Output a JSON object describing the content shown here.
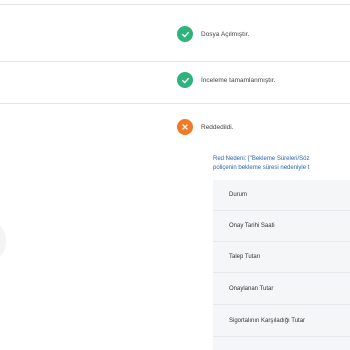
{
  "colors": {
    "success": "#2fb37c",
    "rejected": "#f07a2a",
    "link": "#2a63b8"
  },
  "statuses": [
    {
      "icon": "check-circle-icon",
      "text": "Dosya Açılmıştır."
    },
    {
      "icon": "check-circle-icon",
      "text": "İnceleme tamamlanmıştır."
    },
    {
      "icon": "x-circle-icon",
      "text": "Reddedildi."
    }
  ],
  "rejection": {
    "line1": "Red Nedeni: [\"Bekleme Süreleri/Söz",
    "line2": "poliçenin bekleme süresi nedeniyle t"
  },
  "details": {
    "labels": [
      "Durum",
      "Onay Tarihi Saati",
      "Talep Tutarı",
      "Onaylanan Tutar",
      "Sigortalının Karşıladığı Tutar"
    ]
  }
}
